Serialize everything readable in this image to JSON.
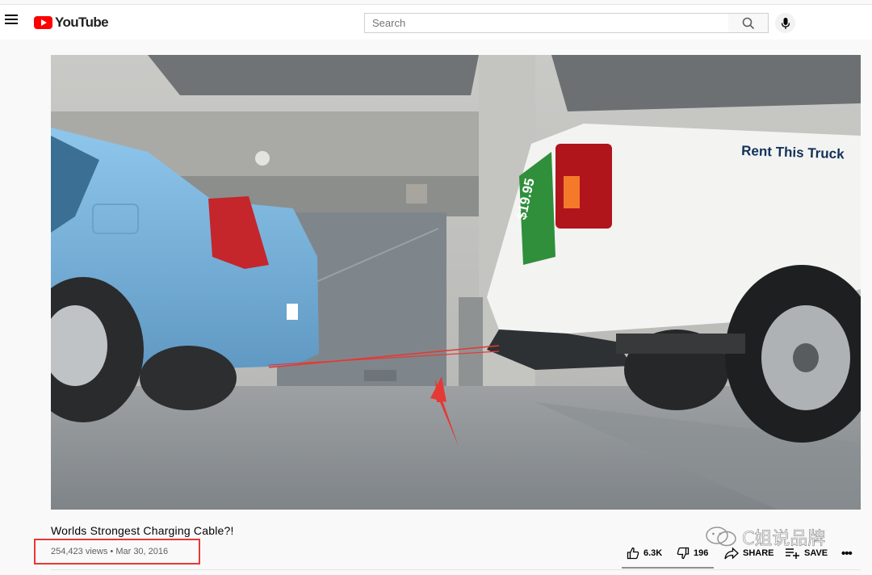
{
  "header": {
    "logo_text": "YouTube",
    "search_placeholder": "Search"
  },
  "video": {
    "scene_text": {
      "truck_side": "Rent This Truck",
      "price_sticker": "$19.95"
    },
    "title": "Worlds Strongest Charging Cable?!",
    "views": "254,423 views",
    "separator": "•",
    "date": "Mar 30, 2016"
  },
  "actions": {
    "like_count": "6.3K",
    "dislike_count": "196",
    "share_label": "SHARE",
    "save_label": "SAVE"
  },
  "watermark": {
    "text": "C姐说品牌"
  },
  "colors": {
    "brand_red": "#ff0000",
    "highlight_box": "#e53935",
    "annotation_arrow": "#e53935"
  }
}
